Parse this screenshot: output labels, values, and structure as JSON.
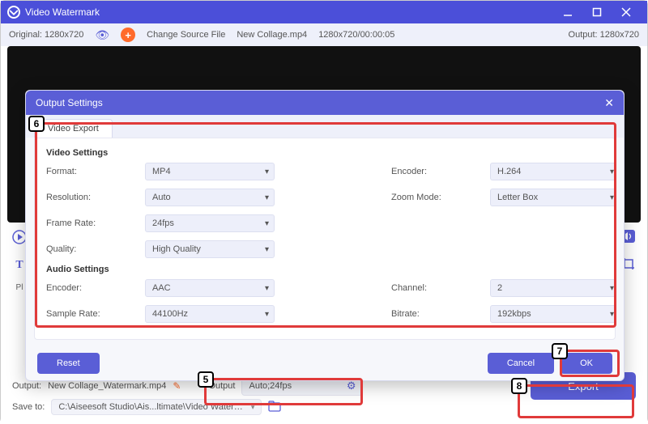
{
  "app_title": "Video Watermark",
  "toolbar": {
    "original": "Original: 1280x720",
    "change_source": "Change Source File",
    "filename": "New Collage.mp4",
    "dims_time": "1280x720/00:00:05",
    "output": "Output: 1280x720"
  },
  "modal": {
    "title": "Output Settings",
    "tab": "Video Export",
    "video_heading": "Video Settings",
    "audio_heading": "Audio Settings",
    "labels": {
      "format": "Format:",
      "encoder_v": "Encoder:",
      "resolution": "Resolution:",
      "zoom": "Zoom Mode:",
      "framerate": "Frame Rate:",
      "quality": "Quality:",
      "encoder_a": "Encoder:",
      "channel": "Channel:",
      "samplerate": "Sample Rate:",
      "bitrate": "Bitrate:"
    },
    "values": {
      "format": "MP4",
      "encoder_v": "H.264",
      "resolution": "Auto",
      "zoom": "Letter Box",
      "framerate": "24fps",
      "quality": "High Quality",
      "encoder_a": "AAC",
      "channel": "2",
      "samplerate": "44100Hz",
      "bitrate": "192kbps"
    },
    "buttons": {
      "reset": "Reset",
      "cancel": "Cancel",
      "ok": "OK"
    }
  },
  "bottom": {
    "output_label": "Output:",
    "output_file": "New Collage_Watermark.mp4",
    "output2_label": "Output",
    "output2_value": "Auto;24fps",
    "saveto_label": "Save to:",
    "saveto_path": "C:\\Aiseesoft Studio\\Ais...ltimate\\Video Watermark",
    "export": "Export"
  },
  "left_label": "Pl",
  "callouts": {
    "c5": "5",
    "c6": "6",
    "c7": "7",
    "c8": "8"
  }
}
